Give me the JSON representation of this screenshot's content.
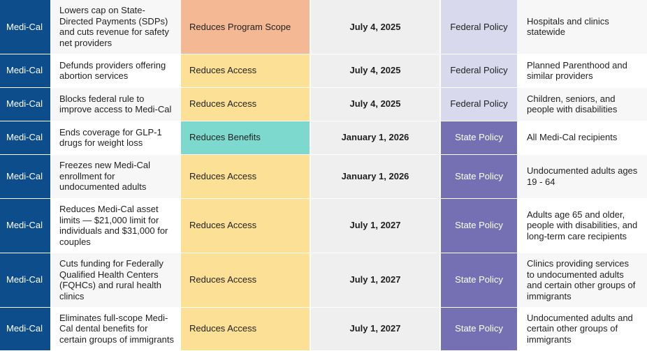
{
  "colors": {
    "program_bg": "#0e4d8c",
    "reduces_program_scope": "#f5b895",
    "reduces_access": "#fce095",
    "reduces_benefits": "#7dd8ce",
    "federal_policy": "#d9d9ee",
    "state_policy": "#7570b3",
    "date_bg": "#efefef"
  },
  "rows": [
    {
      "program": "Medi-Cal",
      "description": "Lowers cap on State-Directed Payments (SDPs) and cuts revenue for safety net providers",
      "impact": "Reduces Program Scope",
      "impact_color": "#f5b895",
      "date": "July 4, 2025",
      "policy": "Federal Policy",
      "policy_color": "#d9d9ee",
      "policy_text_color": "#1f1f1f",
      "affected": "Hospitals and clinics statewide"
    },
    {
      "program": "Medi-Cal",
      "description": "Defunds providers offering abortion services",
      "impact": "Reduces Access",
      "impact_color": "#fce095",
      "date": "July 4, 2025",
      "policy": "Federal Policy",
      "policy_color": "#d9d9ee",
      "policy_text_color": "#1f1f1f",
      "affected": "Planned Parenthood and similar providers"
    },
    {
      "program": "Medi-Cal",
      "description": "Blocks federal rule to improve access to Medi-Cal",
      "impact": "Reduces Access",
      "impact_color": "#fce095",
      "date": "July 4, 2025",
      "policy": "Federal Policy",
      "policy_color": "#d9d9ee",
      "policy_text_color": "#1f1f1f",
      "affected": "Children, seniors, and people with disabilities"
    },
    {
      "program": "Medi-Cal",
      "description": "Ends coverage for GLP-1 drugs for weight loss",
      "impact": "Reduces Benefits",
      "impact_color": "#7dd8ce",
      "date": "January 1, 2026",
      "policy": "State Policy",
      "policy_color": "#7570b3",
      "policy_text_color": "#ffffff",
      "affected": "All Medi-Cal recipients"
    },
    {
      "program": "Medi-Cal",
      "description": "Freezes new Medi-Cal enrollment for undocumented adults",
      "impact": "Reduces Access",
      "impact_color": "#fce095",
      "date": "January 1, 2026",
      "policy": "State Policy",
      "policy_color": "#7570b3",
      "policy_text_color": "#ffffff",
      "affected": "Undocumented adults ages 19 - 64"
    },
    {
      "program": "Medi-Cal",
      "description": "Reduces Medi-Cal asset limits — $21,000 limit for individuals and $31,000 for couples",
      "impact": "Reduces Access",
      "impact_color": "#fce095",
      "date": "July 1, 2027",
      "policy": "State Policy",
      "policy_color": "#7570b3",
      "policy_text_color": "#ffffff",
      "affected": "Adults age 65 and older, people with disabilities, and long-term care recipients"
    },
    {
      "program": "Medi-Cal",
      "description": "Cuts funding for Federally Qualified Health Centers (FQHCs) and rural health clinics",
      "impact": "Reduces Access",
      "impact_color": "#fce095",
      "date": "July 1, 2027",
      "policy": "State Policy",
      "policy_color": "#7570b3",
      "policy_text_color": "#ffffff",
      "affected": "Clinics providing services to undocumented adults and certain other groups of immigrants"
    },
    {
      "program": "Medi-Cal",
      "description": "Eliminates full-scope Medi-Cal dental benefits for certain groups of immigrants",
      "impact": "Reduces Access",
      "impact_color": "#fce095",
      "date": "July 1, 2027",
      "policy": "State Policy",
      "policy_color": "#7570b3",
      "policy_text_color": "#ffffff",
      "affected": "Undocumented adults and certain other groups of immigrants"
    }
  ]
}
